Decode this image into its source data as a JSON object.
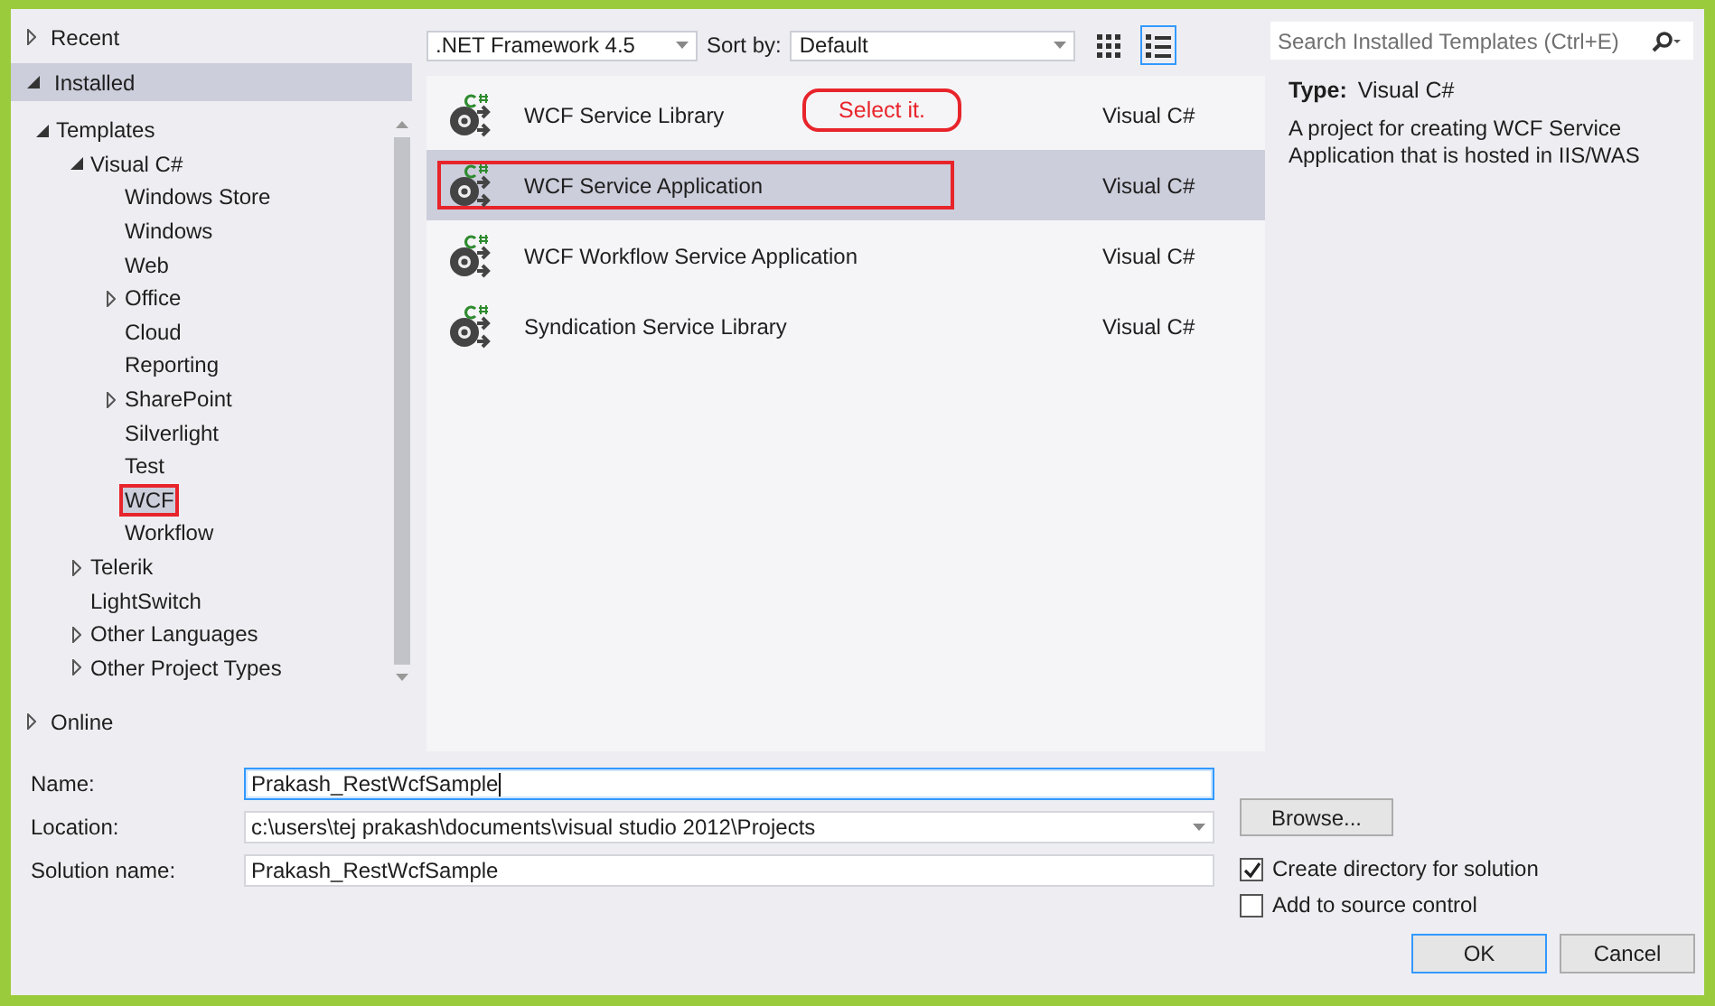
{
  "sections": [
    {
      "label": "Recent",
      "expanded": false,
      "selected": false
    },
    {
      "label": "Installed",
      "expanded": true,
      "selected": true,
      "children": [
        {
          "label": "Templates",
          "expanded": true,
          "selected": false,
          "annotated": false,
          "children": [
            {
              "label": "Visual C#",
              "expanded": true,
              "selected": false,
              "annotated": false,
              "children": [
                {
                  "label": "Windows Store",
                  "selected": false,
                  "annotated": false
                },
                {
                  "label": "Windows",
                  "selected": false,
                  "annotated": false
                },
                {
                  "label": "Web",
                  "selected": false,
                  "annotated": false
                },
                {
                  "label": "Office",
                  "expanded": false,
                  "selected": false,
                  "annotated": false
                },
                {
                  "label": "Cloud",
                  "selected": false,
                  "annotated": false
                },
                {
                  "label": "Reporting",
                  "selected": false,
                  "annotated": false
                },
                {
                  "label": "SharePoint",
                  "expanded": false,
                  "selected": false,
                  "annotated": false
                },
                {
                  "label": "Silverlight",
                  "selected": false,
                  "annotated": false
                },
                {
                  "label": "Test",
                  "selected": false,
                  "annotated": false
                },
                {
                  "label": "WCF",
                  "selected": true,
                  "annotated": true
                },
                {
                  "label": "Workflow",
                  "selected": false,
                  "annotated": false
                }
              ]
            },
            {
              "label": "Telerik",
              "expanded": false,
              "selected": false,
              "annotated": false
            },
            {
              "label": "LightSwitch",
              "selected": false,
              "annotated": false
            },
            {
              "label": "Other Languages",
              "expanded": false,
              "selected": false,
              "annotated": false
            },
            {
              "label": "Other Project Types",
              "expanded": false,
              "selected": false,
              "annotated": false
            }
          ]
        }
      ]
    },
    {
      "label": "Online",
      "expanded": false,
      "selected": false
    }
  ],
  "toolbar": {
    "framework": ".NET Framework 4.5",
    "sort_label": "Sort by:",
    "sort_value": "Default",
    "views": [
      {
        "kind": "grid",
        "selected": false
      },
      {
        "kind": "list",
        "selected": true
      }
    ]
  },
  "search": {
    "placeholder": "Search Installed Templates (Ctrl+E)"
  },
  "templates": [
    {
      "name": "WCF Service Library",
      "language": "Visual C#",
      "selected": false,
      "annotated": false
    },
    {
      "name": "WCF Service Application",
      "language": "Visual C#",
      "selected": true,
      "annotated": true
    },
    {
      "name": "WCF Workflow Service Application",
      "language": "Visual C#",
      "selected": false,
      "annotated": false
    },
    {
      "name": "Syndication Service Library",
      "language": "Visual C#",
      "selected": false,
      "annotated": false
    }
  ],
  "callout": {
    "text": "Select it."
  },
  "details": {
    "type_label": "Type:",
    "type_value": "Visual C#",
    "description": "A project for creating WCF Service Application that is hosted in IIS/WAS"
  },
  "form": {
    "fields": [
      {
        "label": "Name:",
        "value": "Prakash_RestWcfSample",
        "kind": "text",
        "focused": true
      },
      {
        "label": "Location:",
        "value": "c:\\users\\tej prakash\\documents\\visual studio 2012\\Projects",
        "kind": "dropdown",
        "focused": false
      },
      {
        "label": "Solution name:",
        "value": "Prakash_RestWcfSample",
        "kind": "text",
        "focused": false
      }
    ],
    "browse": "Browse...",
    "checkboxes": [
      {
        "label": "Create directory for solution",
        "checked": true
      },
      {
        "label": "Add to source control",
        "checked": false
      }
    ],
    "buttons": [
      {
        "label": "OK",
        "default": true
      },
      {
        "label": "Cancel",
        "default": false
      }
    ]
  }
}
